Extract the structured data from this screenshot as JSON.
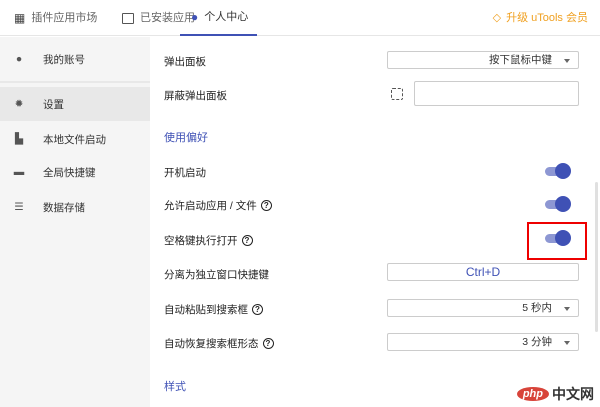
{
  "tabs": [
    {
      "label": "插件应用市场",
      "icon": "grid-icon"
    },
    {
      "label": "已安装应用",
      "icon": "download-monitor-icon"
    },
    {
      "label": "个人中心",
      "icon": "user-gear-icon",
      "active": true
    }
  ],
  "upgrade_label": "升级 uTools 会员",
  "sidebar": {
    "items": [
      {
        "label": "我的账号",
        "icon": "account-icon"
      },
      {
        "label": "设置",
        "icon": "gear-icon",
        "selected": true
      },
      {
        "label": "本地文件启动",
        "icon": "file-icon"
      },
      {
        "label": "全局快捷键",
        "icon": "keyboard-icon"
      },
      {
        "label": "数据存储",
        "icon": "list-icon"
      }
    ]
  },
  "settings": {
    "popup_panel": {
      "label": "弹出面板",
      "value": "按下鼠标中键"
    },
    "block_popup": {
      "label": "屏蔽弹出面板",
      "value": ""
    },
    "section_prefs": "使用偏好",
    "autostart": {
      "label": "开机启动",
      "on": true
    },
    "allow_launch": {
      "label": "允许启动应用 / 文件",
      "on": true
    },
    "space_open": {
      "label": "空格键执行打开",
      "on": true
    },
    "detach_hotkey": {
      "label": "分离为独立窗口快捷键",
      "value": "Ctrl+D"
    },
    "auto_paste": {
      "label": "自动粘贴到搜索框",
      "value": "5 秒内"
    },
    "auto_restore": {
      "label": "自动恢复搜索框形态",
      "value": "3 分钟"
    },
    "section_style": "样式"
  },
  "help_glyph": "?",
  "watermark": "php中文网",
  "colors": {
    "accent": "#3f51b5",
    "upgrade": "#f0a020",
    "highlight": "#e00000"
  }
}
